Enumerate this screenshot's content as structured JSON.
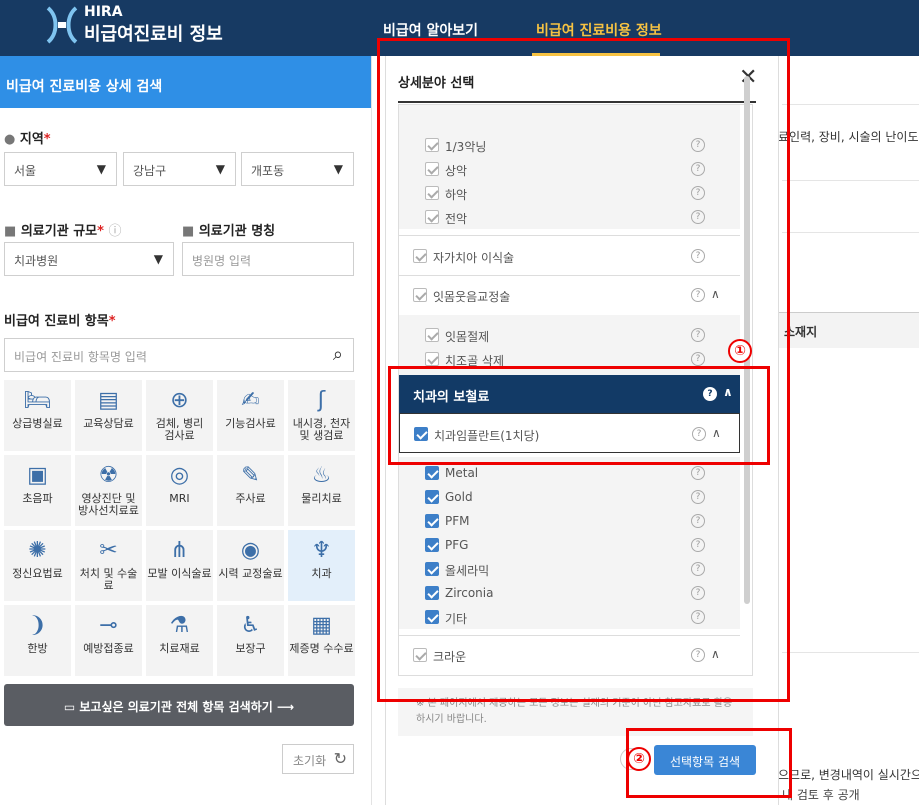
{
  "header": {
    "logo_hira": "HIRA",
    "logo_sub": "비급여진료비 정보",
    "nav": [
      "비급여 알아보기",
      "비급여 진료비용 정보"
    ]
  },
  "left": {
    "title": "비급여 진료비용 상세 검색",
    "region_label": "지역",
    "region": [
      "서울",
      "강남구",
      "개포동"
    ],
    "scale_label": "의료기관 규모",
    "scale_value": "치과병원",
    "name_label": "의료기관 명칭",
    "name_placeholder": "병원명 입력",
    "items_label": "비급여 진료비 항목",
    "items_placeholder": "비급여 진료비 항목명 입력",
    "categories": [
      {
        "label": "상급병실료",
        "icon": "hospital-bed-icon"
      },
      {
        "label": "교육상담료",
        "icon": "consultation-icon"
      },
      {
        "label": "검체, 병리\n검사료",
        "icon": "microscope-icon"
      },
      {
        "label": "기능검사료",
        "icon": "function-test-icon"
      },
      {
        "label": "내시경, 천자\n및 생검료",
        "icon": "endoscope-icon"
      },
      {
        "label": "초음파",
        "icon": "ultrasound-icon"
      },
      {
        "label": "영상진단 및\n방사선치료료",
        "icon": "radiology-icon"
      },
      {
        "label": "MRI",
        "icon": "mri-icon"
      },
      {
        "label": "주사료",
        "icon": "syringe-icon"
      },
      {
        "label": "물리치료",
        "icon": "physiotherapy-icon"
      },
      {
        "label": "정신요법료",
        "icon": "brain-icon"
      },
      {
        "label": "처치 및 수술료",
        "icon": "surgery-icon"
      },
      {
        "label": "모발 이식술료",
        "icon": "hair-icon"
      },
      {
        "label": "시력 교정술료",
        "icon": "eye-icon"
      },
      {
        "label": "치과",
        "icon": "tooth-icon"
      },
      {
        "label": "한방",
        "icon": "ear-icon"
      },
      {
        "label": "예방접종료",
        "icon": "vaccine-icon"
      },
      {
        "label": "치료재료",
        "icon": "material-icon"
      },
      {
        "label": "보장구",
        "icon": "wheelchair-icon"
      },
      {
        "label": "제증명 수수료",
        "icon": "certificate-icon"
      }
    ],
    "search_all": "보고싶은 의료기관 전체 항목 검색하기",
    "reset": "초기화"
  },
  "background": {
    "text1": "료인력, 장비, 시술의 난이도",
    "text2": "소재지",
    "text3": "으므로, 변경내역이 실시간으로",
    "text4": "내 검토 후 공개"
  },
  "modal": {
    "title": "상세분야 선택",
    "rows": [
      {
        "label": "1/3악닝",
        "level": "sub"
      },
      {
        "label": "상악",
        "level": "sub"
      },
      {
        "label": "하악",
        "level": "sub"
      },
      {
        "label": "전악",
        "level": "sub"
      },
      {
        "label": "자가치아 이식술",
        "level": "top"
      },
      {
        "label": "잇몸웃음교정술",
        "level": "top"
      },
      {
        "label": "잇몸절제",
        "level": "sub"
      },
      {
        "label": "치조골 삭제",
        "level": "sub"
      }
    ],
    "section": "치과의 보철료",
    "implant": "치과임플란트(1치당)",
    "materials": [
      "Metal",
      "Gold",
      "PFM",
      "PFG",
      "올세라믹",
      "Zirconia",
      "기타"
    ],
    "crown": "크라운",
    "note": "※ 본 페이지에서 제공하는 모든 정보는 실제의 기준이 아닌 참고자료로 활용하시기 바랍니다.",
    "search_btn": "선택항목 검색"
  },
  "annotations": {
    "one": "①",
    "two": "②"
  }
}
